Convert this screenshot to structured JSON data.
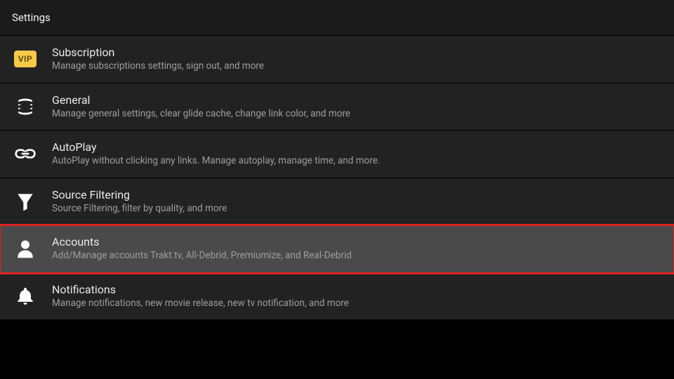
{
  "header": {
    "title": "Settings"
  },
  "items": [
    {
      "icon": "vip",
      "title": "Subscription",
      "subtitle": "Manage subscriptions settings, sign out, and more",
      "badge_text": "VIP"
    },
    {
      "icon": "stack",
      "title": "General",
      "subtitle": "Manage general settings, clear glide cache, change link color, and more"
    },
    {
      "icon": "link",
      "title": "AutoPlay",
      "subtitle": "AutoPlay without clicking any links. Manage autoplay, manage time, and more."
    },
    {
      "icon": "funnel",
      "title": "Source Filtering",
      "subtitle": "Source Filtering, filter by quality, and more"
    },
    {
      "icon": "person",
      "title": "Accounts",
      "subtitle": "Add/Manage accounts Trakt.tv, All-Debrid, Premiumize, and Real-Debrid",
      "selected": true
    },
    {
      "icon": "bell",
      "title": "Notifications",
      "subtitle": "Manage notifications, new movie release, new tv notification, and more"
    }
  ]
}
